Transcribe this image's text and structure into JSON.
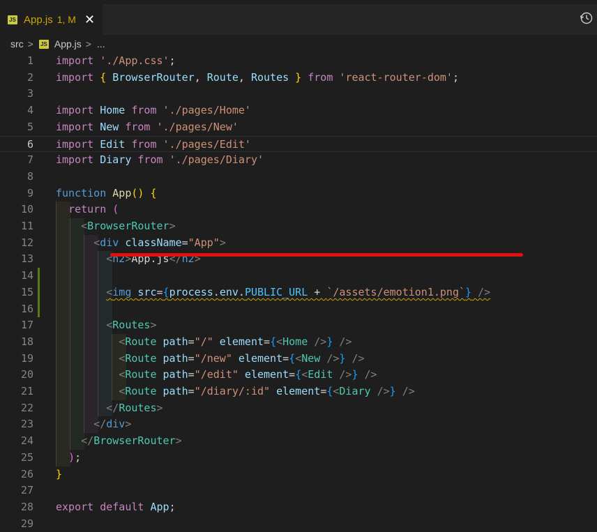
{
  "tab": {
    "label": "App.js",
    "badge": "1, M",
    "close": "✕",
    "file_icon": "js-icon"
  },
  "breadcrumb": {
    "root": "src",
    "sep1": ">",
    "file": "App.js",
    "sep2": ">",
    "more": "..."
  },
  "colors": {
    "background": "#1e1e1e",
    "warning": "#cca700",
    "annotation": "#e01010",
    "added": "#587c0c"
  },
  "lines": [
    {
      "n": "1",
      "t": [
        [
          "kw",
          "import "
        ],
        [
          "str",
          "'./App.css'"
        ],
        [
          "pun",
          ";"
        ]
      ]
    },
    {
      "n": "2",
      "t": [
        [
          "kw",
          "import "
        ],
        [
          "br1",
          "{ "
        ],
        [
          "var",
          "BrowserRouter"
        ],
        [
          "pun",
          ", "
        ],
        [
          "var",
          "Route"
        ],
        [
          "pun",
          ", "
        ],
        [
          "var",
          "Routes"
        ],
        [
          "br1",
          " }"
        ],
        [
          "kw",
          " from "
        ],
        [
          "str",
          "'react-router-dom'"
        ],
        [
          "pun",
          ";"
        ]
      ]
    },
    {
      "n": "3",
      "t": []
    },
    {
      "n": "4",
      "t": [
        [
          "kw",
          "import "
        ],
        [
          "var",
          "Home"
        ],
        [
          "kw",
          " from "
        ],
        [
          "str",
          "'./pages/Home'"
        ]
      ]
    },
    {
      "n": "5",
      "t": [
        [
          "kw",
          "import "
        ],
        [
          "var",
          "New"
        ],
        [
          "kw",
          " from "
        ],
        [
          "str",
          "'./pages/New'"
        ]
      ]
    },
    {
      "n": "6",
      "t": [
        [
          "kw",
          "import "
        ],
        [
          "var",
          "Edit"
        ],
        [
          "kw",
          " from "
        ],
        [
          "str",
          "'./pages/Edit'"
        ]
      ],
      "current": true
    },
    {
      "n": "7",
      "t": [
        [
          "kw",
          "import "
        ],
        [
          "var",
          "Diary"
        ],
        [
          "kw",
          " from "
        ],
        [
          "str",
          "'./pages/Diary'"
        ]
      ]
    },
    {
      "n": "8",
      "t": []
    },
    {
      "n": "9",
      "t": [
        [
          "fn",
          "function "
        ],
        [
          "fname",
          "App"
        ],
        [
          "br1",
          "() {"
        ]
      ]
    },
    {
      "n": "10",
      "t": [
        [
          "pun",
          "  "
        ],
        [
          "kw",
          "return "
        ],
        [
          "br2",
          "("
        ]
      ]
    },
    {
      "n": "11",
      "t": [
        [
          "pun",
          "    "
        ],
        [
          "tagb",
          "<"
        ],
        [
          "tag",
          "BrowserRouter"
        ],
        [
          "tagb",
          ">"
        ]
      ]
    },
    {
      "n": "12",
      "t": [
        [
          "pun",
          "      "
        ],
        [
          "tagb",
          "<"
        ],
        [
          "tagh",
          "div "
        ],
        [
          "attr",
          "className"
        ],
        [
          "pun",
          "="
        ],
        [
          "str",
          "\"App\""
        ],
        [
          "tagb",
          ">"
        ]
      ]
    },
    {
      "n": "13",
      "t": [
        [
          "pun",
          "        "
        ],
        [
          "tagb",
          "<"
        ],
        [
          "tagh",
          "h2"
        ],
        [
          "tagb",
          ">"
        ],
        [
          "pun",
          "App.js"
        ],
        [
          "tagb",
          "</"
        ],
        [
          "tagh",
          "h2"
        ],
        [
          "tagb",
          ">"
        ]
      ]
    },
    {
      "n": "14",
      "t": []
    },
    {
      "n": "15",
      "t": [
        [
          "pun",
          "        "
        ],
        [
          "tagb",
          "<"
        ],
        [
          "tagh",
          "img "
        ],
        [
          "attr",
          "src"
        ],
        [
          "pun",
          "="
        ],
        [
          "br3",
          "{"
        ],
        [
          "var",
          "process"
        ],
        [
          "pun",
          "."
        ],
        [
          "var",
          "env"
        ],
        [
          "pun",
          "."
        ],
        [
          "cst",
          "PUBLIC_URL"
        ],
        [
          "pun",
          " + "
        ],
        [
          "str",
          "`/assets/emotion1.png`"
        ],
        [
          "br3",
          "}"
        ],
        [
          "tagb",
          " />"
        ]
      ],
      "squiggle": true
    },
    {
      "n": "16",
      "t": []
    },
    {
      "n": "17",
      "t": [
        [
          "pun",
          "        "
        ],
        [
          "tagb",
          "<"
        ],
        [
          "tag",
          "Routes"
        ],
        [
          "tagb",
          ">"
        ]
      ]
    },
    {
      "n": "18",
      "t": [
        [
          "pun",
          "          "
        ],
        [
          "tagb",
          "<"
        ],
        [
          "tag",
          "Route "
        ],
        [
          "attr",
          "path"
        ],
        [
          "pun",
          "="
        ],
        [
          "str",
          "\"/\""
        ],
        [
          "attr",
          " element"
        ],
        [
          "pun",
          "="
        ],
        [
          "br3",
          "{"
        ],
        [
          "tagb",
          "<"
        ],
        [
          "tag",
          "Home "
        ],
        [
          "tagb",
          "/>"
        ],
        [
          "br3",
          "}"
        ],
        [
          "tagb",
          " />"
        ]
      ]
    },
    {
      "n": "19",
      "t": [
        [
          "pun",
          "          "
        ],
        [
          "tagb",
          "<"
        ],
        [
          "tag",
          "Route "
        ],
        [
          "attr",
          "path"
        ],
        [
          "pun",
          "="
        ],
        [
          "str",
          "\"/new\""
        ],
        [
          "attr",
          " element"
        ],
        [
          "pun",
          "="
        ],
        [
          "br3",
          "{"
        ],
        [
          "tagb",
          "<"
        ],
        [
          "tag",
          "New "
        ],
        [
          "tagb",
          "/>"
        ],
        [
          "br3",
          "}"
        ],
        [
          "tagb",
          " />"
        ]
      ]
    },
    {
      "n": "20",
      "t": [
        [
          "pun",
          "          "
        ],
        [
          "tagb",
          "<"
        ],
        [
          "tag",
          "Route "
        ],
        [
          "attr",
          "path"
        ],
        [
          "pun",
          "="
        ],
        [
          "str",
          "\"/edit\""
        ],
        [
          "attr",
          " element"
        ],
        [
          "pun",
          "="
        ],
        [
          "br3",
          "{"
        ],
        [
          "tagb",
          "<"
        ],
        [
          "tag",
          "Edit "
        ],
        [
          "tagb",
          "/>"
        ],
        [
          "br3",
          "}"
        ],
        [
          "tagb",
          " />"
        ]
      ]
    },
    {
      "n": "21",
      "t": [
        [
          "pun",
          "          "
        ],
        [
          "tagb",
          "<"
        ],
        [
          "tag",
          "Route "
        ],
        [
          "attr",
          "path"
        ],
        [
          "pun",
          "="
        ],
        [
          "str",
          "\"/diary/:id\""
        ],
        [
          "attr",
          " element"
        ],
        [
          "pun",
          "="
        ],
        [
          "br3",
          "{"
        ],
        [
          "tagb",
          "<"
        ],
        [
          "tag",
          "Diary "
        ],
        [
          "tagb",
          "/>"
        ],
        [
          "br3",
          "}"
        ],
        [
          "tagb",
          " />"
        ]
      ]
    },
    {
      "n": "22",
      "t": [
        [
          "pun",
          "        "
        ],
        [
          "tagb",
          "</"
        ],
        [
          "tag",
          "Routes"
        ],
        [
          "tagb",
          ">"
        ]
      ]
    },
    {
      "n": "23",
      "t": [
        [
          "pun",
          "      "
        ],
        [
          "tagb",
          "</"
        ],
        [
          "tagh",
          "div"
        ],
        [
          "tagb",
          ">"
        ]
      ]
    },
    {
      "n": "24",
      "t": [
        [
          "pun",
          "    "
        ],
        [
          "tagb",
          "</"
        ],
        [
          "tag",
          "BrowserRouter"
        ],
        [
          "tagb",
          ">"
        ]
      ]
    },
    {
      "n": "25",
      "t": [
        [
          "pun",
          "  "
        ],
        [
          "br2",
          ")"
        ],
        [
          "pun",
          ";"
        ]
      ]
    },
    {
      "n": "26",
      "t": [
        [
          "br1",
          "}"
        ]
      ]
    },
    {
      "n": "27",
      "t": []
    },
    {
      "n": "28",
      "t": [
        [
          "kw",
          "export "
        ],
        [
          "kw",
          "default "
        ],
        [
          "var",
          "App"
        ],
        [
          "pun",
          ";"
        ]
      ]
    },
    {
      "n": "29",
      "t": []
    }
  ]
}
